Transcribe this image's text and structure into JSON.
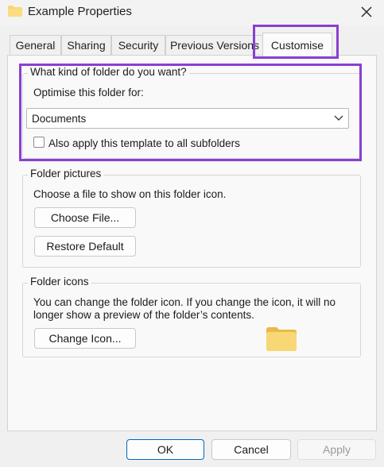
{
  "window": {
    "title": "Example Properties"
  },
  "tabs": [
    {
      "label": "General"
    },
    {
      "label": "Sharing"
    },
    {
      "label": "Security"
    },
    {
      "label": "Previous Versions"
    },
    {
      "label": "Customise"
    }
  ],
  "folder_type": {
    "group_title": "What kind of folder do you want?",
    "optimise_label": "Optimise this folder for:",
    "dropdown_value": "Documents",
    "apply_subfolders_label": "Also apply this template to all subfolders",
    "apply_subfolders_checked": false
  },
  "folder_pictures": {
    "group_title": "Folder pictures",
    "description": "Choose a file to show on this folder icon.",
    "choose_file_label": "Choose File...",
    "restore_default_label": "Restore Default"
  },
  "folder_icons": {
    "group_title": "Folder icons",
    "description_line1": "You can change the folder icon. If you change the icon, it will no",
    "description_line2": "longer show a preview of the folder’s contents.",
    "change_icon_label": "Change Icon..."
  },
  "footer": {
    "ok_label": "OK",
    "cancel_label": "Cancel",
    "apply_label": "Apply"
  },
  "colors": {
    "highlight": "#8a3fd1",
    "primary_border": "#0067c0",
    "folder": "#f8d775"
  },
  "icons": {
    "title": "folder-icon",
    "close": "close-icon",
    "dropdown": "chevron-down-icon",
    "preview": "folder-icon"
  }
}
